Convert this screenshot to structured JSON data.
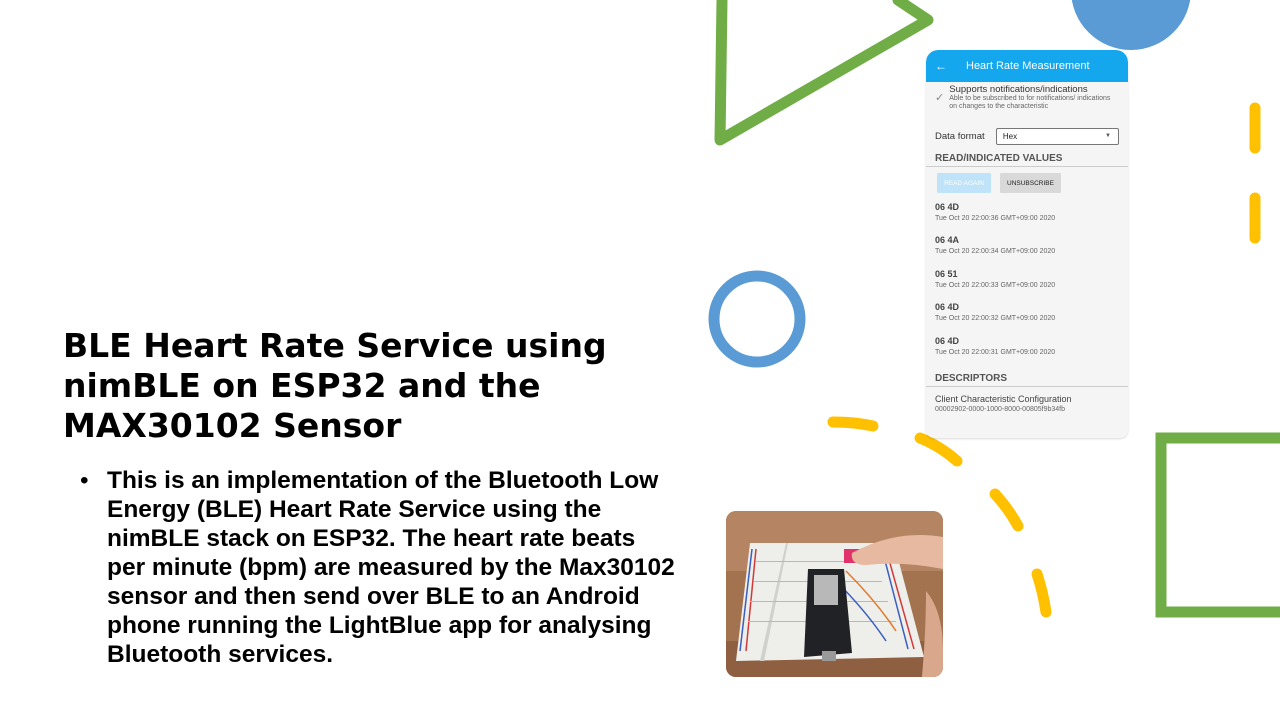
{
  "slide": {
    "title": "BLE Heart Rate Service using nimBLE on ESP32 and the MAX30102 Sensor",
    "bullet": "This is an implementation of the Bluetooth Low Energy (BLE) Heart Rate Service using the nimBLE stack on ESP32. The heart rate beats per minute (bpm) are measured by the Max30102 sensor and then send over BLE to an Android phone running the LightBlue app for analysing Bluetooth services.",
    "bullet_marker": "•"
  },
  "colors": {
    "green": "#70ad47",
    "blue": "#5b9bd5",
    "yellow": "#ffc000",
    "appbar": "#14a7ee"
  },
  "phone": {
    "back_icon": "←",
    "title": "Heart Rate Measurement",
    "check_icon": "✓",
    "supports_title": "Supports notifications/indications",
    "supports_desc": "Able to be subscribed to for notifications/ indications on changes to the characteristic",
    "data_format_label": "Data format",
    "data_format_value": "Hex",
    "values_header": "READ/INDICATED VALUES",
    "read_again": "READ AGAIN",
    "unsubscribe": "UNSUBSCRIBE",
    "values": [
      {
        "hex": "06 4D",
        "time": "Tue Oct 20 22:00:36 GMT+09:00 2020"
      },
      {
        "hex": "06 4A",
        "time": "Tue Oct 20 22:00:34 GMT+09:00 2020"
      },
      {
        "hex": "06 51",
        "time": "Tue Oct 20 22:00:33 GMT+09:00 2020"
      },
      {
        "hex": "06 4D",
        "time": "Tue Oct 20 22:00:32 GMT+09:00 2020"
      },
      {
        "hex": "06 4D",
        "time": "Tue Oct 20 22:00:31 GMT+09:00 2020"
      }
    ],
    "descriptors_header": "DESCRIPTORS",
    "descriptor_name": "Client Characteristic Configuration",
    "descriptor_uuid": "00002902-0000-1000-8000-00805f9b34fb"
  }
}
